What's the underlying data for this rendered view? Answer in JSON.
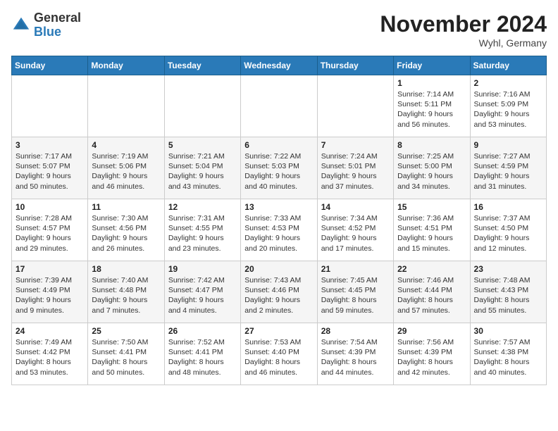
{
  "logo": {
    "line1": "General",
    "line2": "Blue"
  },
  "title": "November 2024",
  "subtitle": "Wyhl, Germany",
  "days_of_week": [
    "Sunday",
    "Monday",
    "Tuesday",
    "Wednesday",
    "Thursday",
    "Friday",
    "Saturday"
  ],
  "weeks": [
    [
      {
        "day": "",
        "info": ""
      },
      {
        "day": "",
        "info": ""
      },
      {
        "day": "",
        "info": ""
      },
      {
        "day": "",
        "info": ""
      },
      {
        "day": "",
        "info": ""
      },
      {
        "day": "1",
        "info": "Sunrise: 7:14 AM\nSunset: 5:11 PM\nDaylight: 9 hours\nand 56 minutes."
      },
      {
        "day": "2",
        "info": "Sunrise: 7:16 AM\nSunset: 5:09 PM\nDaylight: 9 hours\nand 53 minutes."
      }
    ],
    [
      {
        "day": "3",
        "info": "Sunrise: 7:17 AM\nSunset: 5:07 PM\nDaylight: 9 hours\nand 50 minutes."
      },
      {
        "day": "4",
        "info": "Sunrise: 7:19 AM\nSunset: 5:06 PM\nDaylight: 9 hours\nand 46 minutes."
      },
      {
        "day": "5",
        "info": "Sunrise: 7:21 AM\nSunset: 5:04 PM\nDaylight: 9 hours\nand 43 minutes."
      },
      {
        "day": "6",
        "info": "Sunrise: 7:22 AM\nSunset: 5:03 PM\nDaylight: 9 hours\nand 40 minutes."
      },
      {
        "day": "7",
        "info": "Sunrise: 7:24 AM\nSunset: 5:01 PM\nDaylight: 9 hours\nand 37 minutes."
      },
      {
        "day": "8",
        "info": "Sunrise: 7:25 AM\nSunset: 5:00 PM\nDaylight: 9 hours\nand 34 minutes."
      },
      {
        "day": "9",
        "info": "Sunrise: 7:27 AM\nSunset: 4:59 PM\nDaylight: 9 hours\nand 31 minutes."
      }
    ],
    [
      {
        "day": "10",
        "info": "Sunrise: 7:28 AM\nSunset: 4:57 PM\nDaylight: 9 hours\nand 29 minutes."
      },
      {
        "day": "11",
        "info": "Sunrise: 7:30 AM\nSunset: 4:56 PM\nDaylight: 9 hours\nand 26 minutes."
      },
      {
        "day": "12",
        "info": "Sunrise: 7:31 AM\nSunset: 4:55 PM\nDaylight: 9 hours\nand 23 minutes."
      },
      {
        "day": "13",
        "info": "Sunrise: 7:33 AM\nSunset: 4:53 PM\nDaylight: 9 hours\nand 20 minutes."
      },
      {
        "day": "14",
        "info": "Sunrise: 7:34 AM\nSunset: 4:52 PM\nDaylight: 9 hours\nand 17 minutes."
      },
      {
        "day": "15",
        "info": "Sunrise: 7:36 AM\nSunset: 4:51 PM\nDaylight: 9 hours\nand 15 minutes."
      },
      {
        "day": "16",
        "info": "Sunrise: 7:37 AM\nSunset: 4:50 PM\nDaylight: 9 hours\nand 12 minutes."
      }
    ],
    [
      {
        "day": "17",
        "info": "Sunrise: 7:39 AM\nSunset: 4:49 PM\nDaylight: 9 hours\nand 9 minutes."
      },
      {
        "day": "18",
        "info": "Sunrise: 7:40 AM\nSunset: 4:48 PM\nDaylight: 9 hours\nand 7 minutes."
      },
      {
        "day": "19",
        "info": "Sunrise: 7:42 AM\nSunset: 4:47 PM\nDaylight: 9 hours\nand 4 minutes."
      },
      {
        "day": "20",
        "info": "Sunrise: 7:43 AM\nSunset: 4:46 PM\nDaylight: 9 hours\nand 2 minutes."
      },
      {
        "day": "21",
        "info": "Sunrise: 7:45 AM\nSunset: 4:45 PM\nDaylight: 8 hours\nand 59 minutes."
      },
      {
        "day": "22",
        "info": "Sunrise: 7:46 AM\nSunset: 4:44 PM\nDaylight: 8 hours\nand 57 minutes."
      },
      {
        "day": "23",
        "info": "Sunrise: 7:48 AM\nSunset: 4:43 PM\nDaylight: 8 hours\nand 55 minutes."
      }
    ],
    [
      {
        "day": "24",
        "info": "Sunrise: 7:49 AM\nSunset: 4:42 PM\nDaylight: 8 hours\nand 53 minutes."
      },
      {
        "day": "25",
        "info": "Sunrise: 7:50 AM\nSunset: 4:41 PM\nDaylight: 8 hours\nand 50 minutes."
      },
      {
        "day": "26",
        "info": "Sunrise: 7:52 AM\nSunset: 4:41 PM\nDaylight: 8 hours\nand 48 minutes."
      },
      {
        "day": "27",
        "info": "Sunrise: 7:53 AM\nSunset: 4:40 PM\nDaylight: 8 hours\nand 46 minutes."
      },
      {
        "day": "28",
        "info": "Sunrise: 7:54 AM\nSunset: 4:39 PM\nDaylight: 8 hours\nand 44 minutes."
      },
      {
        "day": "29",
        "info": "Sunrise: 7:56 AM\nSunset: 4:39 PM\nDaylight: 8 hours\nand 42 minutes."
      },
      {
        "day": "30",
        "info": "Sunrise: 7:57 AM\nSunset: 4:38 PM\nDaylight: 8 hours\nand 40 minutes."
      }
    ]
  ]
}
